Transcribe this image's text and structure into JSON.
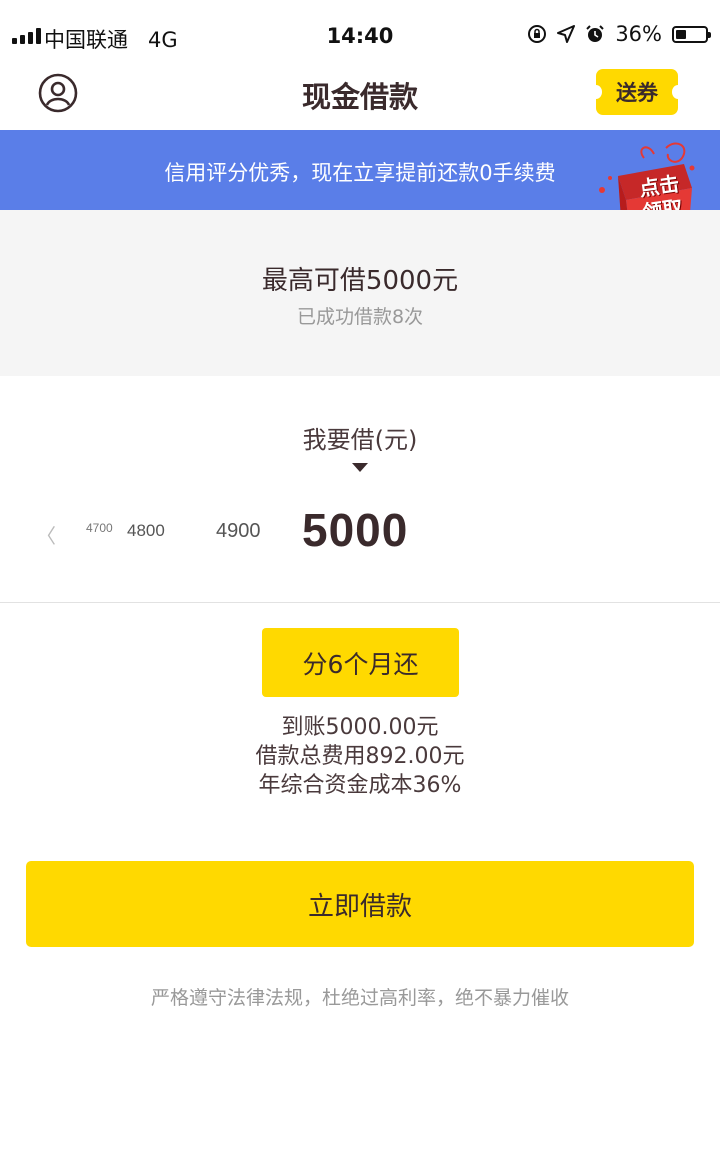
{
  "status_bar": {
    "carrier": "中国联通",
    "network": "4G",
    "time": "14:40",
    "battery": "36%",
    "battery_level": 0.36,
    "icons": [
      "orientation-lock-icon",
      "location-arrow-icon",
      "alarm-icon",
      "battery-icon"
    ]
  },
  "header": {
    "title": "现金借款",
    "coupon_label": "送券",
    "profile_icon": "user-profile-icon"
  },
  "promo": {
    "text": "信用评分优秀，现在立享提前还款0手续费",
    "gift_line1": "点击",
    "gift_line2": "领取"
  },
  "limit": {
    "title": "最高可借5000元",
    "subtitle": "已成功借款8次"
  },
  "amount_picker": {
    "label": "我要借(元)",
    "options": [
      "4700",
      "4800",
      "4900",
      "5000"
    ],
    "selected": "5000"
  },
  "terms": {
    "term_label": "分6个月还",
    "received": "到账5000.00元",
    "total_fee": "借款总费用892.00元",
    "annual_cost": "年综合资金成本36%"
  },
  "cta": {
    "label": "立即借款"
  },
  "disclaimer": "严格遵守法律法规，杜绝过高利率，绝不暴力催收",
  "colors": {
    "accent_yellow": "#ffd900",
    "banner_blue": "#5a7ee8",
    "text_dark": "#3a2a2c",
    "text_muted": "#999999",
    "gift_red": "#e53935"
  }
}
